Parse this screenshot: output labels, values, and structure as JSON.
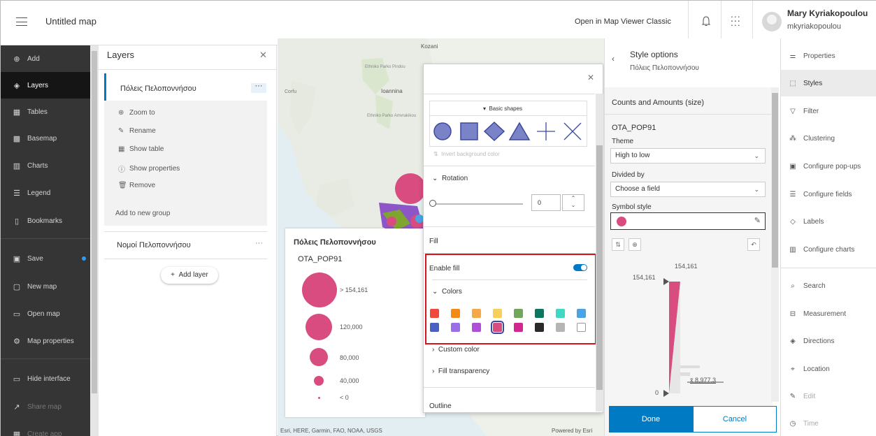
{
  "header": {
    "title": "Untitled map",
    "classic_link": "Open in Map Viewer Classic",
    "user_name": "Mary Kyriakopoulou",
    "user_id": "mkyriakopoulou"
  },
  "left_nav": {
    "items": [
      {
        "label": "Add",
        "icon": "plus-circle-icon",
        "glyph": "⊕"
      },
      {
        "label": "Layers",
        "icon": "layers-icon",
        "glyph": "◈"
      },
      {
        "label": "Tables",
        "icon": "table-icon",
        "glyph": "▦"
      },
      {
        "label": "Basemap",
        "icon": "basemap-icon",
        "glyph": "▩"
      },
      {
        "label": "Charts",
        "icon": "charts-icon",
        "glyph": "▥"
      },
      {
        "label": "Legend",
        "icon": "legend-icon",
        "glyph": "☰"
      },
      {
        "label": "Bookmarks",
        "icon": "bookmark-icon",
        "glyph": "▯"
      },
      {
        "label": "Save",
        "icon": "save-icon",
        "glyph": "▣"
      },
      {
        "label": "New map",
        "icon": "new-map-icon",
        "glyph": "▢"
      },
      {
        "label": "Open map",
        "icon": "folder-icon",
        "glyph": "▭"
      },
      {
        "label": "Map properties",
        "icon": "gear-icon",
        "glyph": "⚙"
      },
      {
        "label": "Hide interface",
        "icon": "monitor-icon",
        "glyph": "▭"
      },
      {
        "label": "Share map",
        "icon": "share-icon",
        "glyph": "↗"
      },
      {
        "label": "Create app",
        "icon": "apps-icon",
        "glyph": "▦"
      }
    ]
  },
  "layers_panel": {
    "title": "Layers",
    "layer1": "Πόλεις Πελοποννήσου",
    "menu": [
      {
        "label": "Zoom to",
        "glyph": "⊕",
        "icon": "zoom-icon"
      },
      {
        "label": "Rename",
        "glyph": "✎",
        "icon": "pencil-icon"
      },
      {
        "label": "Show table",
        "glyph": "▦",
        "icon": "table-icon"
      },
      {
        "label": "Show properties",
        "glyph": "ⓘ",
        "icon": "info-icon"
      },
      {
        "label": "Remove",
        "glyph": "🗑",
        "icon": "trash-icon"
      }
    ],
    "add_group": "Add to new group",
    "layer2": "Νομοί Πελοποννήσου",
    "add_layer": "Add layer"
  },
  "map": {
    "places": [
      "Kozani",
      "Ioannina",
      "Corfu",
      "Ethniko Parko Pindou",
      "Ethniko Parko Amvrakikou"
    ],
    "attribution": "Esri, HERE, Garmin, FAO, NOAA, USGS",
    "powered": "Powered by Esri"
  },
  "legend": {
    "title": "Πόλεις Πελοποννήσου",
    "field": "OTA_POP91",
    "classes": [
      "> 154,161",
      "120,000",
      "80,000",
      "40,000",
      "< 0"
    ],
    "color": "#d84c80"
  },
  "symbol_popup": {
    "shapes_header": "Basic shapes",
    "invert": "Invert background color",
    "rotation_label": "Rotation",
    "rotation_value": "0",
    "fill_label": "Fill",
    "enable_fill": "Enable fill",
    "colors_label": "Colors",
    "custom_color": "Custom color",
    "fill_transparency": "Fill transparency",
    "outline": "Outline",
    "swatches": [
      "#f04a3a",
      "#f38a17",
      "#f5a84a",
      "#f9cf5b",
      "#71a65b",
      "#0a7762",
      "#3fd8c4",
      "#4aa4e4",
      "#4a60c2",
      "#9b6de7",
      "#ad4fd7",
      "#d84c80",
      "#d1278f",
      "#2a2a2a",
      "#b5b5b5",
      "#ffffff"
    ]
  },
  "style_options": {
    "title": "Style options",
    "subtitle": "Πόλεις Πελοποννήσου",
    "section": "Counts and Amounts (size)",
    "field": "OTA_POP91",
    "theme_label": "Theme",
    "theme_value": "High to low",
    "divided_label": "Divided by",
    "divided_value": "Choose a field",
    "symbol_label": "Symbol style",
    "hist_max": "154,161",
    "hist_handle_top": "154,161",
    "hist_min": "0",
    "mean": "x̄ 8,977.3",
    "done": "Done",
    "cancel": "Cancel"
  },
  "right_rail": {
    "items": [
      {
        "label": "Properties",
        "glyph": "⚌",
        "icon": "properties-icon"
      },
      {
        "label": "Styles",
        "glyph": "⬚",
        "icon": "styles-icon"
      },
      {
        "label": "Filter",
        "glyph": "▽",
        "icon": "filter-icon"
      },
      {
        "label": "Clustering",
        "glyph": "⁂",
        "icon": "clustering-icon"
      },
      {
        "label": "Configure pop-ups",
        "glyph": "▣",
        "icon": "popup-icon"
      },
      {
        "label": "Configure fields",
        "glyph": "☰",
        "icon": "fields-icon"
      },
      {
        "label": "Labels",
        "glyph": "◇",
        "icon": "labels-icon"
      },
      {
        "label": "Configure charts",
        "glyph": "▥",
        "icon": "charts-icon"
      },
      {
        "label": "Search",
        "glyph": "⌕",
        "icon": "search-icon"
      },
      {
        "label": "Measurement",
        "glyph": "⊟",
        "icon": "measure-icon"
      },
      {
        "label": "Directions",
        "glyph": "◈",
        "icon": "directions-icon"
      },
      {
        "label": "Location",
        "glyph": "⌖",
        "icon": "location-icon"
      },
      {
        "label": "Edit",
        "glyph": "✎",
        "icon": "edit-icon"
      },
      {
        "label": "Time",
        "glyph": "◷",
        "icon": "time-icon"
      }
    ]
  }
}
